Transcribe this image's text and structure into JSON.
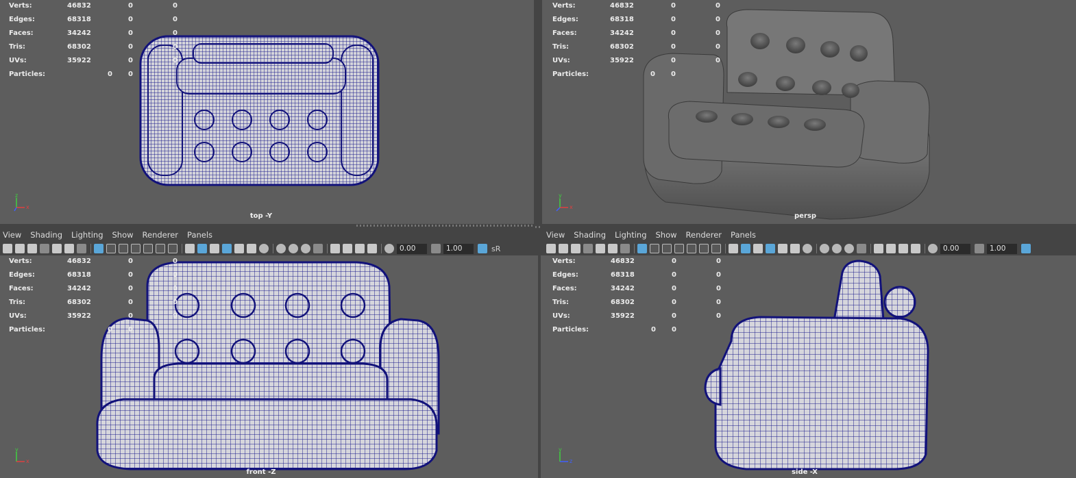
{
  "stats": {
    "labels": {
      "verts": "Verts:",
      "edges": "Edges:",
      "faces": "Faces:",
      "tris": "Tris:",
      "uvs": "UVs:",
      "particles": "Particles:"
    },
    "verts": [
      "46832",
      "0",
      "0"
    ],
    "edges": [
      "68318",
      "0",
      "0"
    ],
    "faces": [
      "34242",
      "0",
      "0"
    ],
    "tris": [
      "68302",
      "0",
      "0"
    ],
    "uvs": [
      "35922",
      "0",
      "0"
    ],
    "particles": [
      "0",
      "0"
    ]
  },
  "viewports": {
    "top": {
      "camera": "top -Y"
    },
    "persp": {
      "camera": "persp"
    },
    "front": {
      "camera": "front -Z"
    },
    "side": {
      "camera": "side -X"
    }
  },
  "panel_menu": {
    "view": "View",
    "shading": "Shading",
    "lighting": "Lighting",
    "show": "Show",
    "renderer": "Renderer",
    "panels": "Panels"
  },
  "toolbar": {
    "exposure": "0.00",
    "gamma": "1.00",
    "color_space": "sR"
  },
  "axis": {
    "x": "x",
    "y": "y",
    "z": "z"
  },
  "colors": {
    "viewport_bg": "#5d5d5d",
    "wireframe": "#1c1c8c",
    "mesh_fill": "#d6d6dc",
    "shaded": "#6a6a6a",
    "active_icon": "#5aa6d8"
  }
}
